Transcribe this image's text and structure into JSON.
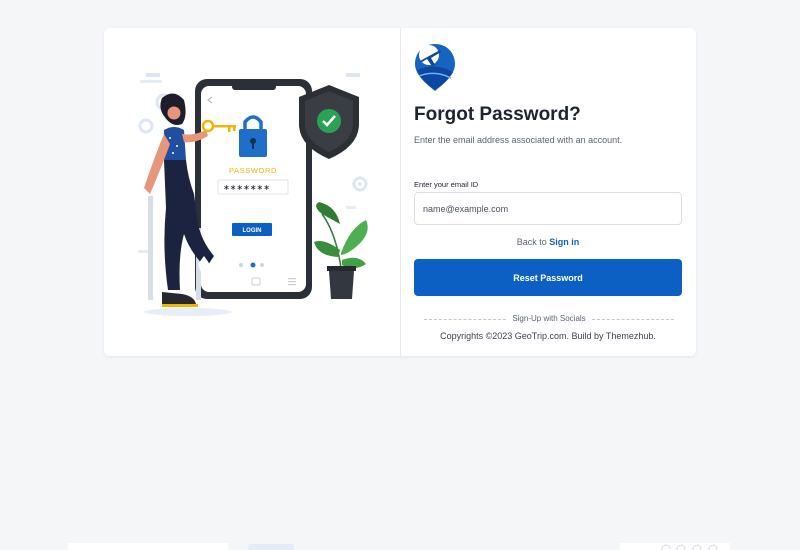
{
  "colors": {
    "primary": "#0c60c4",
    "link": "#1262b9",
    "heading": "#1d2330",
    "muted": "#5b6372",
    "page_background": "#f5f6f8",
    "card_background": "#ffffff",
    "shield": "#2c2f33",
    "check": "#29a353",
    "lock": "#1e6fc8",
    "illustration_password_label": "#f5b400"
  },
  "illustration": {
    "password_label": "PASSWORD",
    "masked_password": "∗∗∗∗∗∗∗",
    "login_label": "LOGIN",
    "icons": [
      "phone-icon",
      "lock-icon",
      "shield-check-icon",
      "plant-icon",
      "gear-icon",
      "key-icon"
    ]
  },
  "logo": {
    "icon": "location-pin-plane-icon"
  },
  "form": {
    "title": "Forgot Password?",
    "subtitle": "Enter the email address associated with an account.",
    "email_label": "Enter your email ID",
    "email_placeholder": "name@example.com",
    "email_value": "",
    "back_text": "Back to",
    "signin_link": "Sign in",
    "reset_button": "Reset Password",
    "socials_text": "Sign-Up with Socials",
    "copyright": "Copyrights ©2023 GeoTrip.com. Build by Themezhub."
  }
}
